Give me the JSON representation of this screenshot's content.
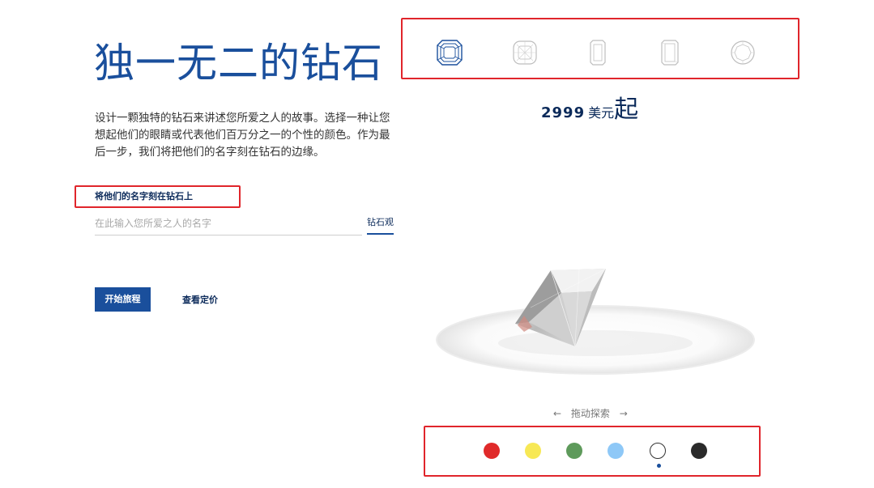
{
  "hero": {
    "title": "独一无二的钻石",
    "description": "设计一颗独特的钻石来讲述您所爱之人的故事。选择一种让您想起他们的眼睛或代表他们百万分之一的个性的颜色。作为最后一步，我们将把他们的名字刻在钻石的边缘。"
  },
  "engrave": {
    "label": "将他们的名字刻在钻石上",
    "placeholder": "在此输入您所爱之人的名字",
    "preview_label": "钻石观"
  },
  "actions": {
    "start_label": "开始旅程",
    "pricing_label": "查看定价"
  },
  "shapes": {
    "items": [
      "asscher-cut-icon",
      "cushion-cut-icon",
      "emerald-cut-icon",
      "radiant-cut-icon",
      "round-cut-icon"
    ],
    "selected": "asscher-cut-icon"
  },
  "price": {
    "amount": "2999",
    "currency": "美元",
    "suffix": "起"
  },
  "drag_hint": {
    "left_arrow": "←",
    "text": "拖动探索",
    "right_arrow": "→"
  },
  "colors": {
    "swatches": [
      "#e02a2a",
      "#f7e855",
      "#5e9a5b",
      "#8ec8f7",
      "#ffffff",
      "#2a2a2a"
    ],
    "selected": "#ffffff"
  },
  "theme": {
    "brand": "#1a4f9c",
    "highlight": "#e0252b"
  }
}
